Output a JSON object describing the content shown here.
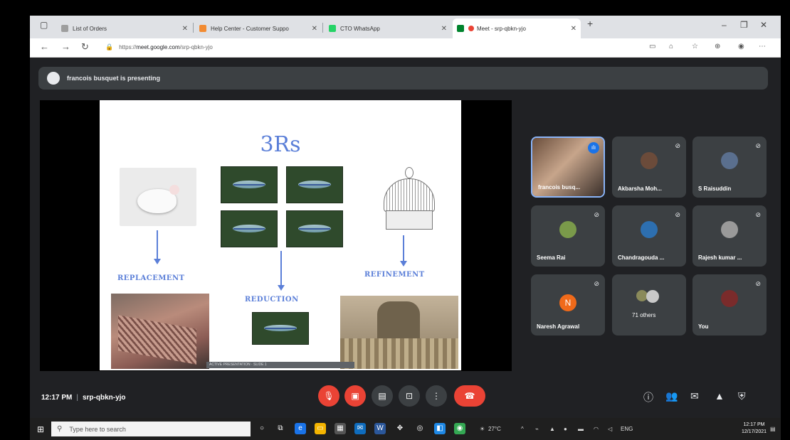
{
  "tabs": [
    {
      "title": "List of Orders",
      "favicon_color": "#9e9e9e"
    },
    {
      "title": "Help Center - Customer Suppo",
      "favicon_color": "#f28b32"
    },
    {
      "title": "CTO WhatsApp",
      "favicon_color": "#25d366"
    },
    {
      "title": "Meet - srp-qbkn-yjo",
      "favicon_color": "#00832d"
    }
  ],
  "address": {
    "scheme": "https://",
    "host": "meet.google.com",
    "path": "/srp-qbkn-yjo"
  },
  "banner": {
    "text": "francois busquet is presenting"
  },
  "slide": {
    "title": "3Rs",
    "labels": [
      "REPLACEMENT",
      "REDUCTION",
      "REFINEMENT"
    ],
    "caption": "ACTIVE PRESENTATION · SLIDE 1"
  },
  "participants": [
    {
      "name": "francois busq...",
      "self": false,
      "initial": ""
    },
    {
      "name": "Akbarsha Moh...",
      "self": false,
      "initial": ""
    },
    {
      "name": "S Raisuddin",
      "self": false,
      "initial": ""
    },
    {
      "name": "Seema Rai",
      "self": false,
      "initial": ""
    },
    {
      "name": "Chandragouda ...",
      "self": false,
      "initial": ""
    },
    {
      "name": "Rajesh kumar ...",
      "self": false,
      "initial": ""
    },
    {
      "name": "Naresh Agrawal",
      "self": false,
      "initial": "N"
    },
    {
      "name": "71 others",
      "self": false,
      "initial": ""
    },
    {
      "name": "You",
      "self": true,
      "initial": ""
    }
  ],
  "meeting": {
    "time": "12:17 PM",
    "separator": "|",
    "code": "srp-qbkn-yjo"
  },
  "taskbar": {
    "search_placeholder": "Type here to search",
    "weather": "27°C",
    "lang": "ENG",
    "clock_time": "12:17 PM",
    "clock_date": "12/17/2021"
  },
  "colors": {
    "meet_bg": "#202124",
    "tile_bg": "#3c4043",
    "accent": "#5b7fd8",
    "red": "#ea4335"
  }
}
